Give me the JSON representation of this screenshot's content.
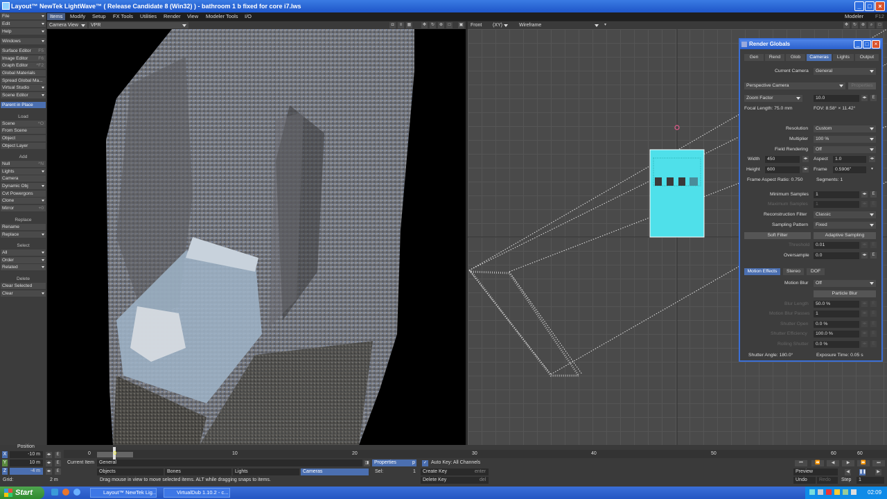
{
  "window": {
    "title": "Layout™ NewTek LightWave™ ( Release Candidate 8 (Win32) ) - bathroom 1 b fixed for core i7.lws",
    "minimize": "_",
    "maximize": "□",
    "close": "×"
  },
  "menubar": {
    "tabs": [
      "Items",
      "Modify",
      "Setup",
      "FX Tools",
      "Utilities",
      "Render",
      "View",
      "Modeler Tools",
      "I/O"
    ],
    "right_label": "Modeler",
    "right_hotkey": "F12"
  },
  "leftpanel": {
    "top": [
      {
        "label": "File",
        "dd": true
      },
      {
        "label": "Edit",
        "dd": true
      },
      {
        "label": "Help",
        "dd": true
      },
      {
        "label": "Windows",
        "dd": true
      }
    ],
    "editors": [
      {
        "label": "Surface Editor",
        "hk": "F5"
      },
      {
        "label": "Image Editor",
        "hk": "F6"
      },
      {
        "label": "Graph Editor",
        "hk": "^F2"
      },
      {
        "label": "Global Materials",
        "hk": ""
      },
      {
        "label": "Spread Global Ma...",
        "hk": ""
      },
      {
        "label": "Virtual Studio",
        "hk": ""
      },
      {
        "label": "Scene Editor",
        "hk": ""
      }
    ],
    "parent": "Parent in Place",
    "load_h": "Load",
    "load": [
      {
        "label": "Scene",
        "hk": "^O"
      },
      {
        "label": "From Scene",
        "hk": ""
      },
      {
        "label": "Object",
        "hk": ""
      },
      {
        "label": "Object Layer",
        "hk": ""
      }
    ],
    "add_h": "Add",
    "add": [
      {
        "label": "Null",
        "hk": "^N"
      },
      {
        "label": "Lights",
        "hk": ""
      },
      {
        "label": "Camera",
        "hk": ""
      },
      {
        "label": "Dynamic Obj",
        "hk": ""
      },
      {
        "label": "Cvt Powergons",
        "hk": ""
      },
      {
        "label": "Clone",
        "hk": ""
      },
      {
        "label": "Mirror",
        "hk": "+0"
      }
    ],
    "replace_h": "Replace",
    "replace": [
      {
        "label": "Rename",
        "hk": ""
      },
      {
        "label": "Replace",
        "hk": ""
      }
    ],
    "select_h": "Select",
    "select": [
      {
        "label": "All",
        "hk": ""
      },
      {
        "label": "Order",
        "hk": ""
      },
      {
        "label": "Related",
        "hk": ""
      }
    ],
    "delete_h": "Delete",
    "delete": [
      {
        "label": "Clear Selected",
        "hk": ""
      },
      {
        "label": "Clear",
        "hk": ""
      }
    ]
  },
  "viewport_left": {
    "mode": "Camera View",
    "camera": "VPR"
  },
  "viewport_right": {
    "view": "Front",
    "axes": "(XY)",
    "shading": "Wireframe"
  },
  "render_globals": {
    "title": "Render Globals",
    "tabs": [
      "Gen",
      "Rend",
      "Glob",
      "Cameras",
      "Lights",
      "Output"
    ],
    "current_camera_label": "Current Camera",
    "current_camera": "General",
    "camera_type": "Perspective Camera",
    "properties": "Properties",
    "zoom_label": "Zoom Factor",
    "zoom": "10.0",
    "focal": "Focal Length: 75.0 mm",
    "fov": "FOV: 8.58° × 11.42°",
    "resolution_label": "Resolution",
    "resolution": "Custom",
    "multiplier_label": "Multiplier",
    "multiplier": "100 %",
    "field_label": "Field Rendering",
    "field": "Off",
    "width_label": "Width",
    "width": "450",
    "aspect_label": "Aspect",
    "aspect": "1.0",
    "height_label": "Height",
    "height": "600",
    "frame_label": "Frame",
    "frame": "0.5906\"",
    "far": "Frame Aspect Ratio: 0.750",
    "segments": "Segments: 1",
    "min_samples_label": "Minimum Samples",
    "min_samples": "1",
    "max_samples_label": "Maximum Samples",
    "max_samples": "1",
    "recon_label": "Reconstruction Filter",
    "recon": "Classic",
    "pattern_label": "Sampling Pattern",
    "pattern": "Fixed",
    "soft_filter": "Soft Filter",
    "adaptive": "Adaptive Sampling",
    "threshold_label": "Threshold",
    "threshold": "0.01",
    "oversample_label": "Oversample",
    "oversample": "0.0",
    "subtabs": [
      "Motion Effects",
      "Stereo",
      "DOF"
    ],
    "mblur_label": "Motion Blur",
    "mblur": "Off",
    "particle_blur": "Particle Blur",
    "blur_length_label": "Blur Length",
    "blur_length": "50.0 %",
    "blur_passes_label": "Motion Blur Passes",
    "blur_passes": "1",
    "shutter_open_label": "Shutter Open",
    "shutter_open": "0.0 %",
    "shutter_eff_label": "Shutter Efficiency",
    "shutter_eff": "100.0 %",
    "rolling_label": "Rolling Shutter",
    "rolling": "0.0 %",
    "shutter_angle": "Shutter Angle: 180.0°",
    "exposure": "Exposure Time: 0.05 s"
  },
  "timeline": {
    "ticks": [
      "0",
      "10",
      "20",
      "30",
      "40",
      "50",
      "60"
    ],
    "current": "0",
    "end": "60"
  },
  "bottom": {
    "position_label": "Position",
    "x_label": "X",
    "x": "-10 m",
    "y_label": "Y",
    "y": "10 m",
    "z_label": "Z",
    "z": "-4 m",
    "grid_label": "Grid:",
    "grid": "2 m",
    "current_item_label": "Current Item",
    "current_item": "General",
    "objects": "Objects",
    "bones": "Bones",
    "lights": "Lights",
    "cameras": "Cameras",
    "properties": "Properties",
    "p_key": "p",
    "sel_label": "Sel:",
    "sel": "1",
    "autokey": "Auto Key: All Channels",
    "create_key": "Create Key",
    "create_key_hk": "enter",
    "delete_key": "Delete Key",
    "delete_key_hk": "del",
    "status": "Drag mouse in view to move selected items. ALT while dragging snaps to items.",
    "preview": "Preview",
    "undo": "Undo",
    "redo": "Redo",
    "step_label": "Step",
    "step": "1"
  },
  "taskbar": {
    "start": "Start",
    "tasks": [
      "Layout™ NewTek Lig...",
      "VirtualDub 1.10.2 - c..."
    ],
    "clock": "02:09"
  },
  "colors": {
    "accent": "#4b6fb0",
    "title_blue": "#2b60cc",
    "cyan": "#4fe0ea",
    "start_green": "#3c9a3c"
  }
}
